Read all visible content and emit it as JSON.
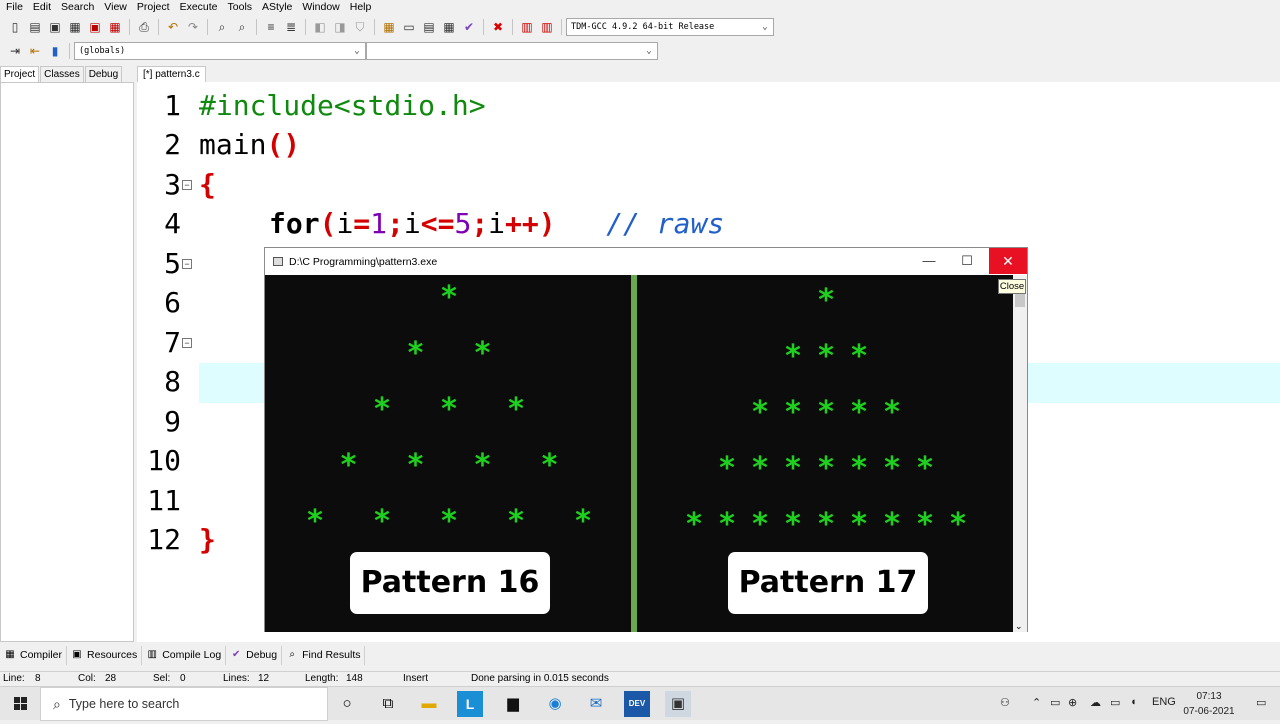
{
  "menubar": [
    "File",
    "Edit",
    "Search",
    "View",
    "Project",
    "Execute",
    "Tools",
    "AStyle",
    "Window",
    "Help"
  ],
  "toolbar": {
    "compiler_select": "TDM-GCC 4.9.2 64-bit Release",
    "scope_select": "(globals)",
    "symbol_select": ""
  },
  "left_tabs": [
    "Project",
    "Classes",
    "Debug"
  ],
  "editor": {
    "tab_label": "[*] pattern3.c",
    "line_numbers": [
      "1",
      "2",
      "3",
      "4",
      "5",
      "6",
      "7",
      "8",
      "9",
      "10",
      "11",
      "12"
    ],
    "code": {
      "l1": "#include<stdio.h>",
      "l2_main": "main",
      "l2_paren": "()",
      "l3_brace": "{",
      "l4_for": "for",
      "l4_open": "(",
      "l4_i1": "i",
      "l4_eq": "=",
      "l4_1": "1",
      "l4_semi1": ";",
      "l4_i2": "i",
      "l4_le": "<=",
      "l4_5": "5",
      "l4_semi2": ";",
      "l4_i3": "i",
      "l4_inc": "++",
      "l4_close": ")",
      "l4_comment": "// raws",
      "l12_brace": "}"
    },
    "highlight_color": "#ddfdff"
  },
  "console": {
    "title": "D:\\C Programming\\pattern3.exe",
    "minimize_glyph": "—",
    "maximize_glyph": "☐",
    "close_glyph": "✕",
    "tooltip": "Close",
    "star_glyph": "*",
    "star_color": "#1fd11f",
    "divider_color": "#6aa84f",
    "pattern16_label": "Pattern 16",
    "pattern17_label": "Pattern 17",
    "pattern16_rows": [
      1,
      2,
      3,
      4,
      5
    ],
    "pattern17_rows": [
      1,
      3,
      5,
      7,
      9
    ]
  },
  "bottom_tabs": [
    {
      "label": "Compiler",
      "icon": "grid-icon"
    },
    {
      "label": "Resources",
      "icon": "resources-icon"
    },
    {
      "label": "Compile Log",
      "icon": "chart-icon"
    },
    {
      "label": "Debug",
      "icon": "check-icon"
    },
    {
      "label": "Find Results",
      "icon": "find-icon"
    }
  ],
  "status": {
    "line_label": "Line:",
    "line_value": "8",
    "col_label": "Col:",
    "col_value": "28",
    "sel_label": "Sel:",
    "sel_value": "0",
    "lines_label": "Lines:",
    "lines_value": "12",
    "length_label": "Length:",
    "length_value": "148",
    "mode": "Insert",
    "message": "Done parsing in 0.015 seconds"
  },
  "taskbar": {
    "search_placeholder": "Type here to search",
    "lang": "ENG",
    "time": "07:13",
    "date": "07-06-2021",
    "dev_label": "DEV"
  }
}
